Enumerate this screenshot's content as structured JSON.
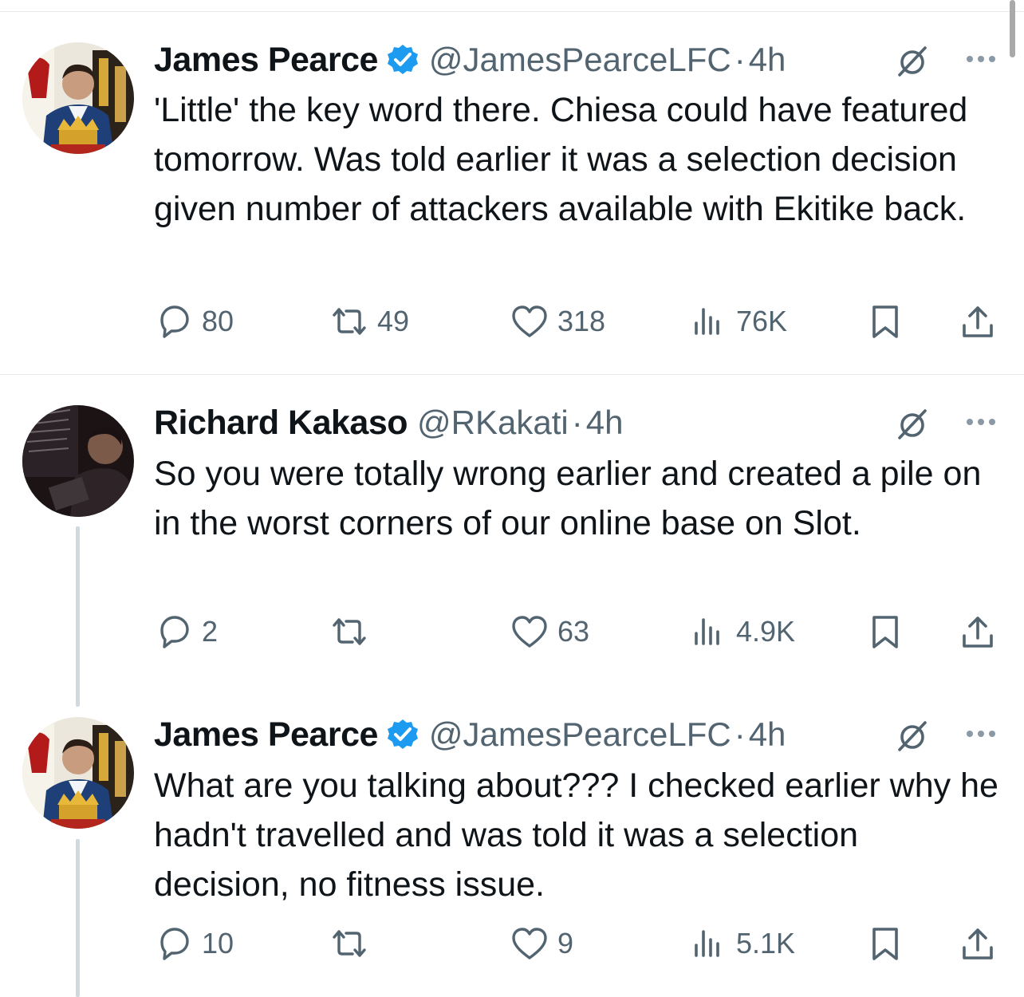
{
  "tweets": [
    {
      "name": "James Pearce",
      "verified": true,
      "handle": "@JamesPearceLFC",
      "sep": "·",
      "time": "4h",
      "text": "'Little' the key word there. Chiesa could have featured tomorrow. Was told earlier it was a selection decision given number of attackers available with Ekitike back.",
      "replies": "80",
      "retweets": "49",
      "likes": "318",
      "views": "76K"
    },
    {
      "name": "Richard Kakaso",
      "verified": false,
      "handle": "@RKakati",
      "sep": "·",
      "time": "4h",
      "text": "So you were totally wrong earlier and created a pile on in the worst corners of our online base on Slot.",
      "replies": "2",
      "retweets": "",
      "likes": "63",
      "views": "4.9K"
    },
    {
      "name": "James Pearce",
      "verified": true,
      "handle": "@JamesPearceLFC",
      "sep": "·",
      "time": "4h",
      "text": "What are you talking about??? I checked earlier why he hadn't travelled and was told it was a selection decision, no fitness issue.",
      "replies": "10",
      "retweets": "",
      "likes": "9",
      "views": "5.1K"
    }
  ],
  "colors": {
    "text": "#0f1419",
    "muted": "#536471",
    "verified": "#1d9bf0",
    "border": "#e6e9ec",
    "thread": "#cfd9de"
  }
}
